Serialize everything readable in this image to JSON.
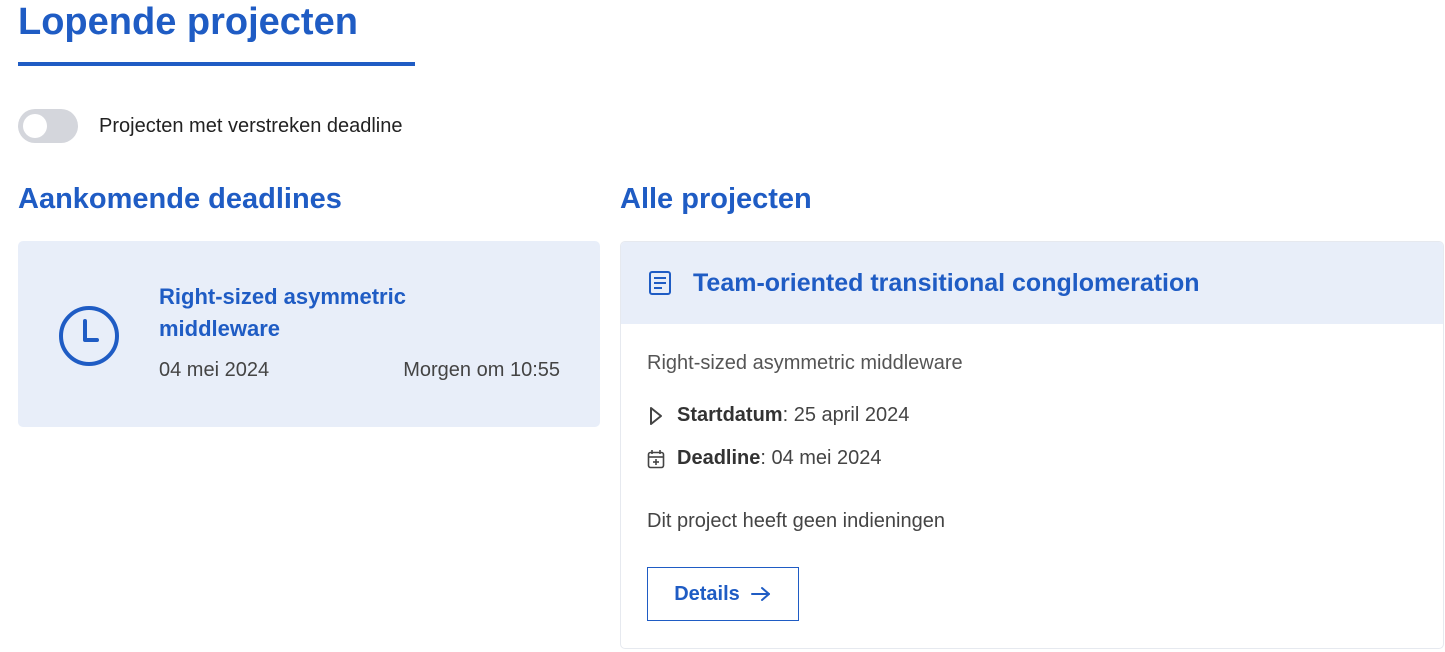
{
  "page": {
    "title": "Lopende projecten"
  },
  "toggle": {
    "label": "Projecten met verstreken deadline",
    "on": false
  },
  "upcoming": {
    "title": "Aankomende deadlines",
    "items": [
      {
        "name": "Right-sized asymmetric middleware",
        "date": "04 mei 2024",
        "relative": "Morgen om 10:55",
        "icon": "clock-icon"
      }
    ]
  },
  "projects": {
    "title": "Alle projecten",
    "items": [
      {
        "title": "Team-oriented transitional conglomeration",
        "subtitle": "Right-sized asymmetric middleware",
        "start_label": "Startdatum",
        "start_value": ": 25 april 2024",
        "deadline_label": "Deadline",
        "deadline_value": ": 04 mei 2024",
        "submissions": "Dit project heeft geen indieningen",
        "details_label": "Details"
      }
    ]
  },
  "colors": {
    "accent": "#1f5cc4",
    "card_bg": "#e8eef9",
    "toggle_off": "#d4d6dc"
  }
}
